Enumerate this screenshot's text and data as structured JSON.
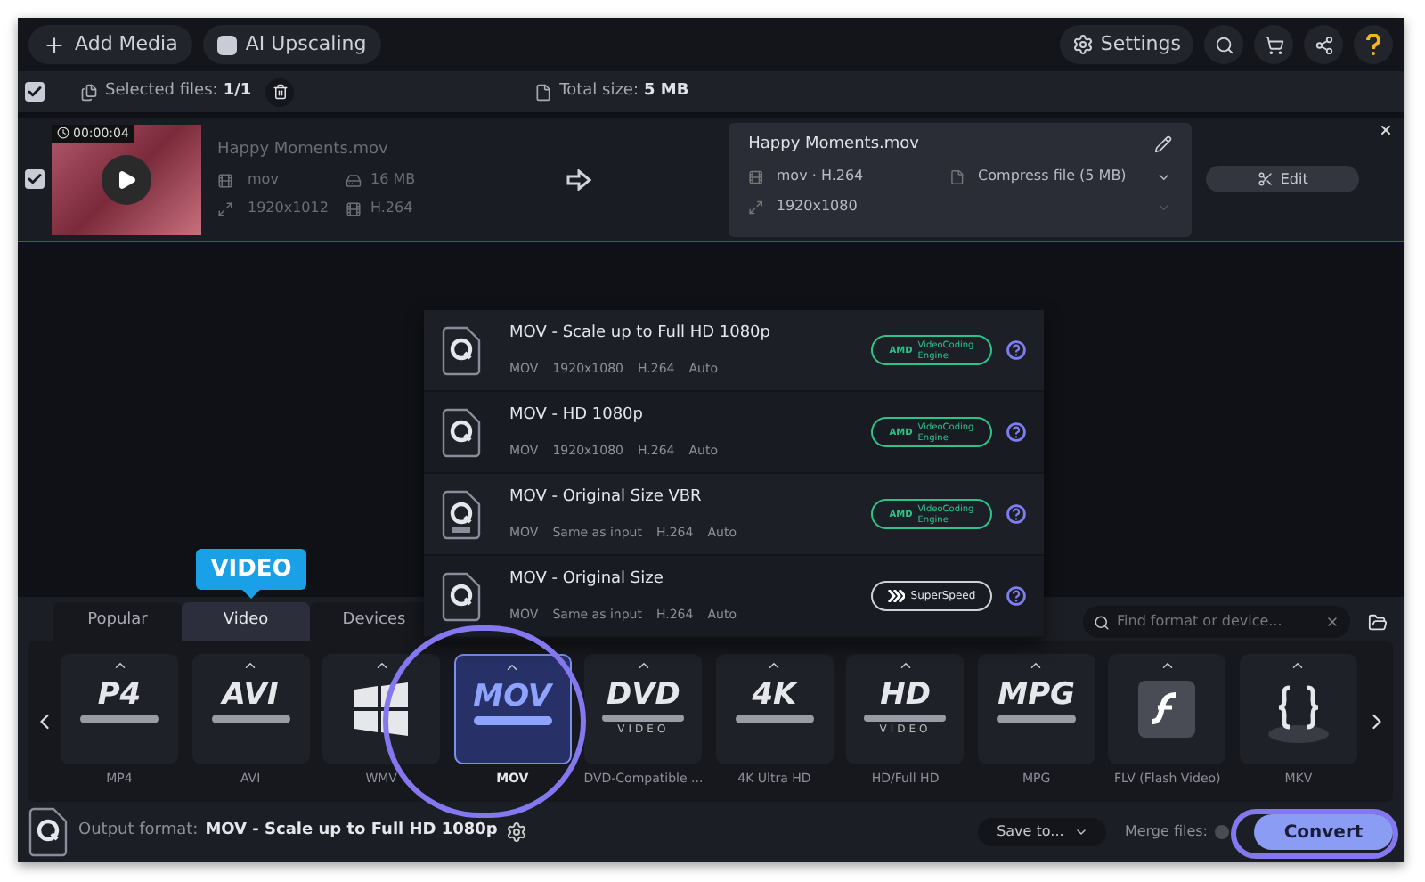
{
  "toolbar": {
    "buttons": [
      {
        "label": "Add Media",
        "kind": "add"
      },
      {
        "label": "AI Upscaling",
        "kind": "ai"
      }
    ],
    "settings": {
      "label": "Settings"
    }
  },
  "selection_bar": {
    "checked": true,
    "selected_label": "Selected files:",
    "selected_value": "1/1",
    "total_label": "Total size:",
    "total_value": "5 MB"
  },
  "file": {
    "checked": true,
    "duration": "00:00:04",
    "name": "Happy Moments.mov",
    "format": "mov",
    "size": "16 MB",
    "resolution": "1920x1012",
    "codec": "H.264",
    "output": {
      "name": "Happy Moments.mov",
      "format": "mov · H.264",
      "compress": "Compress file (5 MB)",
      "resolution": "1920x1080"
    },
    "edit": "Edit"
  },
  "presets": [
    {
      "title": "MOV - Scale up to Full HD 1080p",
      "specs": [
        "MOV",
        "1920x1080",
        "H.264",
        "Auto"
      ],
      "badge": {
        "kind": "amd",
        "brand": "AMD",
        "lines": [
          "VideoCoding",
          "Engine"
        ]
      },
      "vbr": false
    },
    {
      "title": "MOV - HD 1080p",
      "specs": [
        "MOV",
        "1920x1080",
        "H.264",
        "Auto"
      ],
      "badge": {
        "kind": "amd",
        "brand": "AMD",
        "lines": [
          "VideoCoding",
          "Engine"
        ]
      },
      "vbr": false
    },
    {
      "title": "MOV - Original Size VBR",
      "specs": [
        "MOV",
        "Same as input",
        "H.264",
        "Auto"
      ],
      "badge": {
        "kind": "amd",
        "brand": "AMD",
        "lines": [
          "VideoCoding",
          "Engine"
        ]
      },
      "vbr": true
    },
    {
      "title": "MOV - Original Size",
      "specs": [
        "MOV",
        "Same as input",
        "H.264",
        "Auto"
      ],
      "badge": {
        "kind": "superspeed",
        "lines": [
          "SuperSpeed"
        ]
      },
      "vbr": false
    }
  ],
  "callout": {
    "label": "VIDEO"
  },
  "tabs": [
    {
      "label": "Popular",
      "selected": false
    },
    {
      "label": "Video",
      "selected": true
    },
    {
      "label": "Devices",
      "selected": false
    }
  ],
  "search": {
    "placeholder": "Find format or device..."
  },
  "formats": [
    {
      "label": "MP4",
      "kind": "text",
      "logo": "P4",
      "selected": false
    },
    {
      "label": "AVI",
      "kind": "text",
      "logo": "AVI",
      "selected": false
    },
    {
      "label": "WMV",
      "kind": "windows",
      "selected": false
    },
    {
      "label": "MOV",
      "kind": "text",
      "logo": "MOV",
      "selected": true
    },
    {
      "label": "DVD-Compatible ...",
      "kind": "disc",
      "logo": "DVD",
      "sub": "VIDEO",
      "selected": false
    },
    {
      "label": "4K Ultra HD",
      "kind": "text",
      "logo": "4K",
      "selected": false
    },
    {
      "label": "HD/Full HD",
      "kind": "disc",
      "logo": "HD",
      "sub": "VIDEO",
      "selected": false
    },
    {
      "label": "MPG",
      "kind": "text",
      "logo": "MPG",
      "selected": false
    },
    {
      "label": "FLV (Flash Video)",
      "kind": "flash",
      "selected": false
    },
    {
      "label": "MKV",
      "kind": "braces",
      "selected": false
    }
  ],
  "footer": {
    "output_label": "Output format:",
    "output_value": "MOV - Scale up to Full HD 1080p",
    "save": "Save to...",
    "merge_label": "Merge files:",
    "merge_on": false,
    "convert": "Convert"
  }
}
